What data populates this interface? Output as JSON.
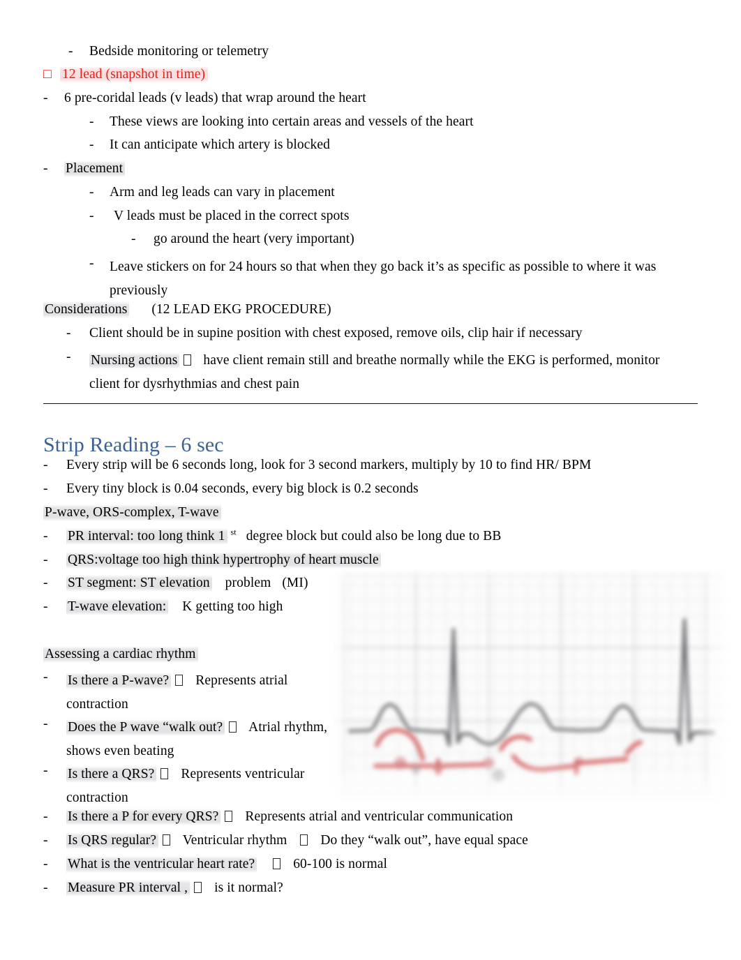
{
  "document": {
    "section_one": {
      "lines": [
        {
          "id": "bedside",
          "text": "Bedside monitoring or telemetry"
        },
        {
          "id": "twelve_lead",
          "text": "12 lead (snapshot in time)"
        },
        {
          "id": "precordial",
          "text": "6 pre-coridal leads (v leads) that wrap around the heart"
        },
        {
          "id": "views",
          "text": "These views are looking into certain areas and vessels of the heart"
        },
        {
          "id": "anticipate",
          "text": "It can anticipate which artery is blocked"
        },
        {
          "id": "placement",
          "text": "Placement"
        },
        {
          "id": "arm_leg",
          "text": "Arm and leg leads can vary in placement"
        },
        {
          "id": "v_leads",
          "text": "V leads must be placed in the correct spots"
        },
        {
          "id": "go_around",
          "text": "go around the heart (very important)"
        },
        {
          "id": "stickers",
          "text": "Leave stickers on for 24 hours so that when they go back it’s as specific as possible to where it was previously"
        }
      ],
      "considerations_label": "Considerations",
      "considerations_title": "(12 LEAD EKG PROCEDURE)",
      "considerations_items": [
        "Client should be in supine position with chest exposed, remove oils, clip hair if necessary"
      ],
      "nursing_actions_label": "Nursing actions",
      "nursing_actions_text": "have client remain still and breathe normally while the EKG is performed, monitor client for dysrhythmias and chest pain"
    },
    "section_two": {
      "heading": "Strip Reading – 6 sec",
      "bullets_top": [
        "Every strip will be 6 seconds long, look for 3 second markers, multiply by 10 to find HR/ BPM",
        "Every tiny block is 0.04 seconds, every big block is 0.2 seconds"
      ],
      "waves_label": "P-wave, ORS-complex, T-wave",
      "pr_interval_pre": "PR interval:  too long think 1",
      "pr_interval_sup": "st",
      "pr_interval_post": "degree block but could also be long due to BB",
      "qrs_voltage": "QRS:voltage too high think hypertrophy of heart muscle",
      "st_segment_a": "ST segment: ST elevation",
      "st_segment_b": "problem",
      "st_segment_c": "(MI)",
      "t_wave_a": "T-wave elevation:",
      "t_wave_b": "K getting too high",
      "assessing_label": "Assessing a cardiac rhythm",
      "assessing_items": [
        {
          "q": "Is there a P-wave?",
          "a": "Represents atrial contraction"
        },
        {
          "q": "Does the P wave “walk out?",
          "a": "Atrial rhythm, shows even beating"
        },
        {
          "q": "Is there a QRS?",
          "a": "Represents ventricular contraction"
        },
        {
          "q": "Is there a P for every QRS?",
          "a": "Represents atrial and ventricular communication"
        },
        {
          "q": "Is QRS regular?",
          "a": "Ventricular rhythm",
          "a2": "Do they “walk out”, have equal space"
        },
        {
          "q": "What is the ventricular heart rate?",
          "a": "60-100 is normal"
        },
        {
          "q": "Measure PR interval ,",
          "a": "is it normal?"
        }
      ]
    },
    "ecg_image": {
      "alt": "Blurred ECG rhythm strip with grid, grey waveform tracing and red handwritten annotations"
    },
    "colors": {
      "heading_blue": "#3b6298",
      "accent_red": "#e8201c",
      "text_black": "#000000"
    }
  }
}
